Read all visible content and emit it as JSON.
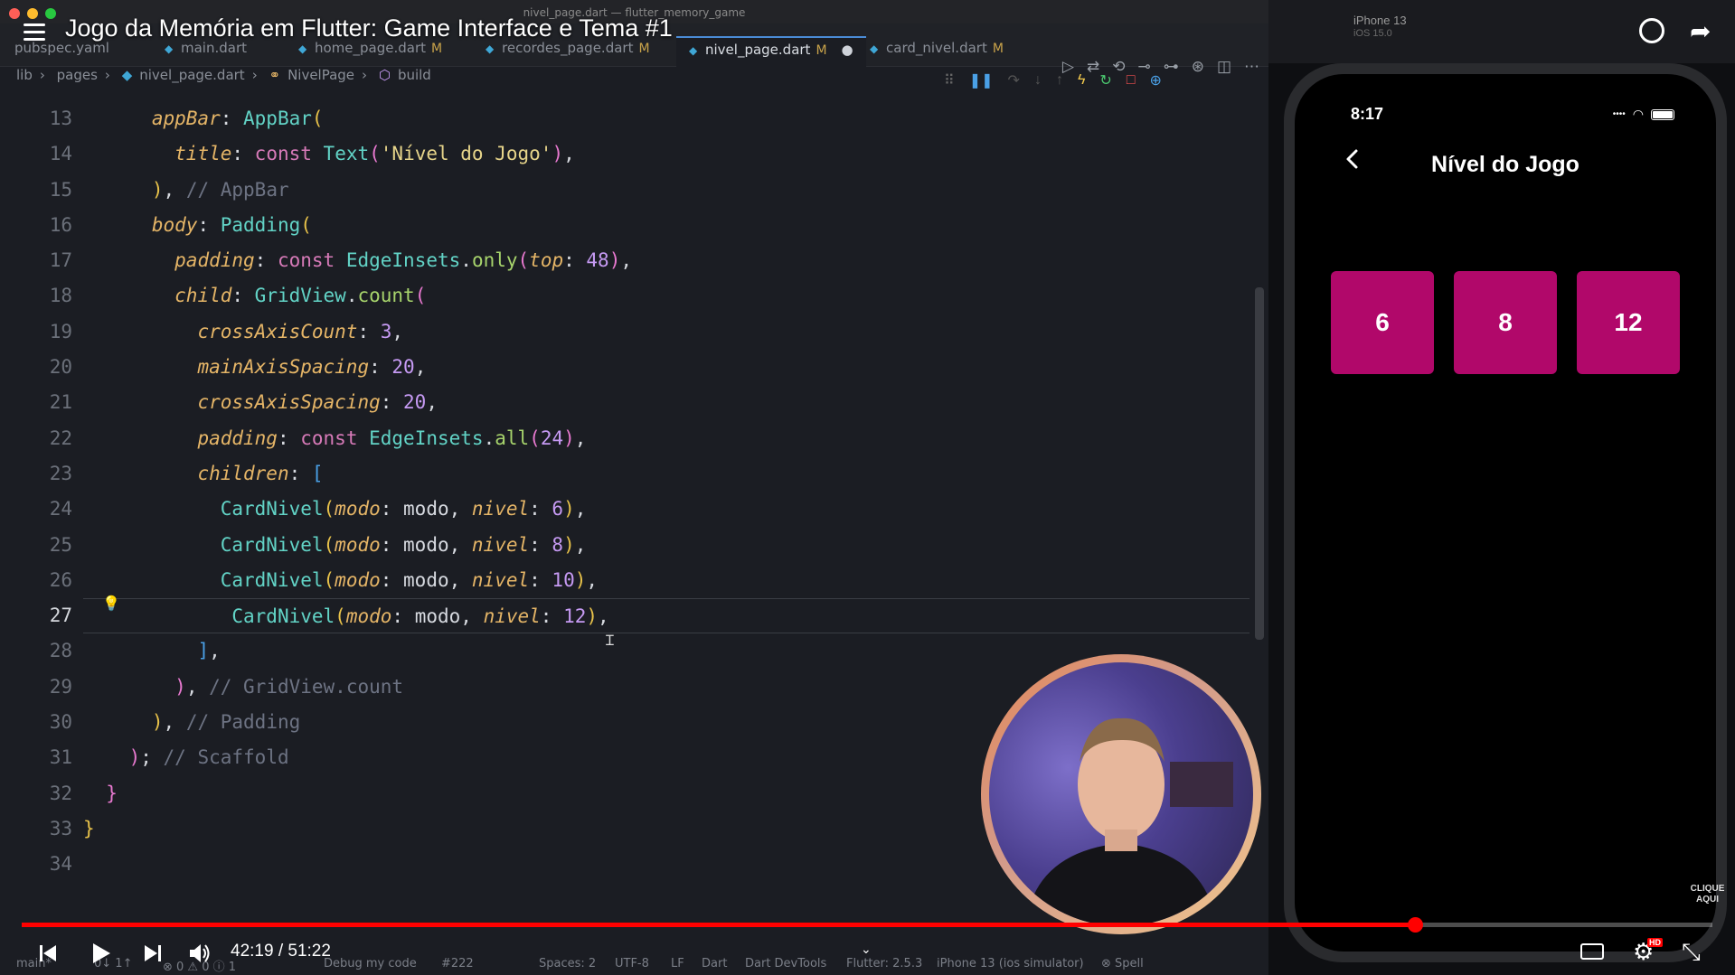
{
  "video": {
    "title": "Jogo da Memória em Flutter: Game Interface e Tema #1",
    "time_current": "42:19",
    "time_total": "51:22",
    "time_display": "42:19 / 51:22",
    "progress": 0.824,
    "colors": {
      "progress": "#ff0000"
    }
  },
  "window": {
    "title": "nivel_page.dart — flutter_memory_game"
  },
  "tabs": [
    {
      "label": "pubspec.yaml",
      "modified": ""
    },
    {
      "label": "main.dart",
      "modified": ""
    },
    {
      "label": "home_page.dart",
      "modified": "M"
    },
    {
      "label": "recordes_page.dart",
      "modified": "M"
    },
    {
      "label": "nivel_page.dart",
      "modified": "M"
    },
    {
      "label": "card_nivel.dart",
      "modified": "M"
    }
  ],
  "breadcrumb": [
    "lib",
    "pages",
    "nivel_page.dart",
    "NivelPage",
    "build"
  ],
  "code": {
    "line_numbers": [
      "13",
      "14",
      "15",
      "16",
      "17",
      "18",
      "19",
      "20",
      "21",
      "22",
      "23",
      "24",
      "25",
      "26",
      "27",
      "28",
      "29",
      "30",
      "31",
      "32",
      "33",
      "34"
    ],
    "current_line": "27"
  },
  "statusbar": {
    "branch": "main*",
    "sync": "0↓ 1↑",
    "problems": "⊗ 0 ⚠ 0 ⓘ 1",
    "debug": "Debug my code",
    "issue": "#222",
    "spaces": "Spaces: 2",
    "encoding": "UTF-8",
    "eol": "LF",
    "language": "Dart",
    "devtools": "Dart DevTools",
    "flutter": "Flutter: 2.5.3",
    "device": "iPhone 13 (ios simulator)",
    "spell": "⊗ Spell"
  },
  "simulator": {
    "device_name": "iPhone 13",
    "os": "iOS 15.0",
    "clock": "8:17",
    "app_title": "Nível do Jogo",
    "levels": [
      "6",
      "8",
      "12"
    ],
    "colors": {
      "card": "#b1086a"
    },
    "clique": "CLIQUE AQUI"
  }
}
